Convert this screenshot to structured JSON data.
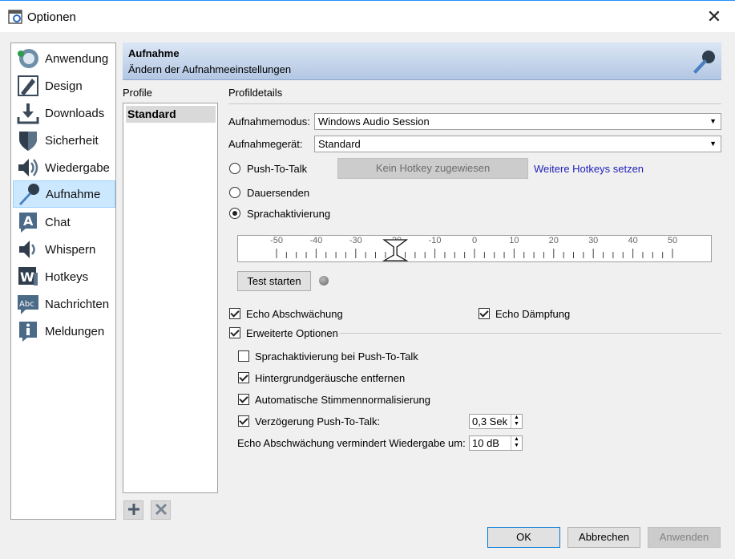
{
  "window": {
    "title": "Optionen"
  },
  "sidebar": {
    "items": [
      {
        "label": "Anwendung",
        "icon": "teamspeak-icon"
      },
      {
        "label": "Design",
        "icon": "design-icon"
      },
      {
        "label": "Downloads",
        "icon": "download-icon"
      },
      {
        "label": "Sicherheit",
        "icon": "shield-icon"
      },
      {
        "label": "Wiedergabe",
        "icon": "speaker-icon"
      },
      {
        "label": "Aufnahme",
        "icon": "microphone-icon",
        "selected": true
      },
      {
        "label": "Chat",
        "icon": "chat-icon"
      },
      {
        "label": "Whispern",
        "icon": "whisper-icon"
      },
      {
        "label": "Hotkeys",
        "icon": "hotkey-icon"
      },
      {
        "label": "Nachrichten",
        "icon": "messages-icon"
      },
      {
        "label": "Meldungen",
        "icon": "info-icon"
      }
    ]
  },
  "header": {
    "title": "Aufnahme",
    "subtitle": "Ändern der Aufnahmeeinstellungen"
  },
  "profiles": {
    "heading": "Profile",
    "items": [
      "Standard"
    ]
  },
  "details": {
    "heading": "Profildetails",
    "mode_label": "Aufnahmemodus:",
    "mode_value": "Windows Audio Session",
    "device_label": "Aufnahmegerät:",
    "device_value": "Standard",
    "ptt_label": "Push-To-Talk",
    "hotkey_button": "Kein Hotkey zugewiesen",
    "more_hotkeys": "Weitere Hotkeys setzen",
    "continuous_label": "Dauersenden",
    "vad_label": "Sprachaktivierung",
    "selected_mode": "Sprachaktivierung",
    "slider": {
      "ticks": [
        "-50",
        "-40",
        "-30",
        "-20",
        "-10",
        "0",
        "10",
        "20",
        "30",
        "40",
        "50"
      ],
      "value": -20
    },
    "test_button": "Test starten",
    "echo_reduction": "Echo Abschwächung",
    "echo_cancel": "Echo Dämpfung",
    "advanced": "Erweiterte Optionen",
    "vad_ptt": "Sprachaktivierung bei Push-To-Talk",
    "bg_noise": "Hintergrundgeräusche entfernen",
    "auto_norm": "Automatische Stimmennormalisierung",
    "ptt_delay_label": "Verzögerung Push-To-Talk:",
    "ptt_delay_value": "0,3 Sek",
    "echo_reduce_label": "Echo Abschwächung vermindert Wiedergabe um:",
    "echo_reduce_value": "10 dB"
  },
  "footer": {
    "ok": "OK",
    "cancel": "Abbrechen",
    "apply": "Anwenden"
  }
}
